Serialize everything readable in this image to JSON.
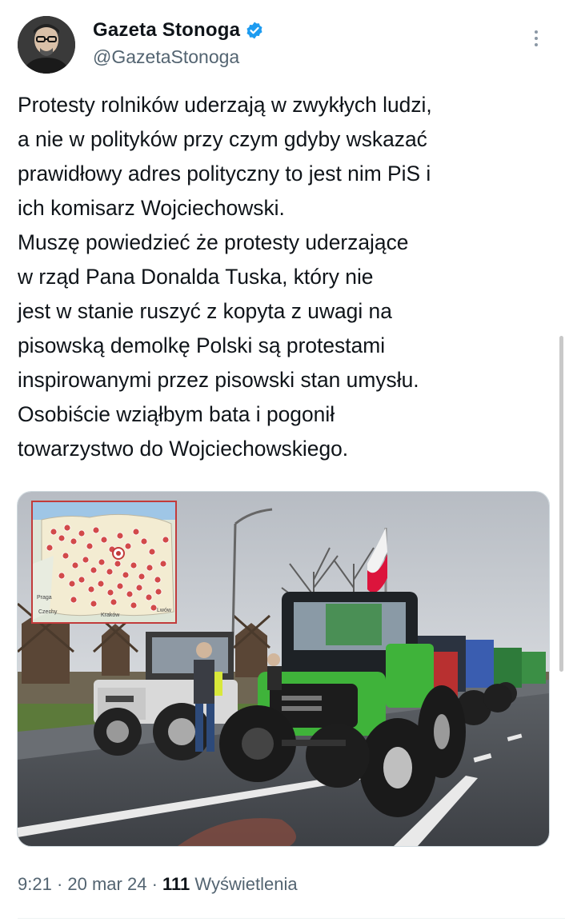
{
  "author": {
    "display_name": "Gazeta Stonoga",
    "handle": "@GazetaStonoga",
    "verified": true,
    "avatar_icon": "user-avatar-icon"
  },
  "tweet": {
    "text": "Protesty rolników uderzają w zwykłych ludzi,\na nie w polityków  przy czym gdyby wskazać\nprawidłowy adres polityczny to jest nim PiS i\nich komisarz Wojciechowski.\nMuszę powiedzieć że protesty uderzające\nw rząd Pana Donalda Tuska, który nie\njest w stanie ruszyć z kopyta z uwagi na\npisowską demolkę Polski są protestami\ninspirowanymi przez pisowski stan umysłu.\nOsobiście wziąłbym bata i pogonił\ntowarzystwo do Wojciechowskiego."
  },
  "media": {
    "map_labels": [
      "Praga",
      "Czechy",
      "Lwów",
      "Kraków"
    ]
  },
  "meta": {
    "time": "9:21",
    "sep1": " · ",
    "date": "20 mar 24",
    "sep2": " · ",
    "views_count": "111",
    "views_label": " Wyświetlenia"
  },
  "colors": {
    "verified_blue": "#1d9bf0",
    "text_primary": "#0f1419",
    "text_secondary": "#536471",
    "tractor_green": "#3fb33a",
    "flag_red": "#dc143c"
  }
}
